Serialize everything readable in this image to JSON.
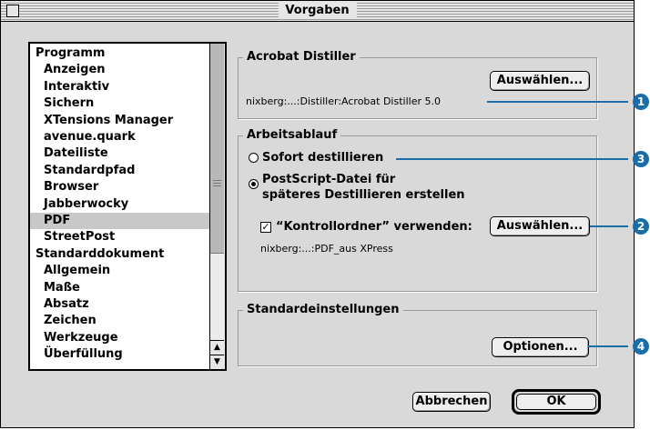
{
  "window": {
    "title": "Vorgaben"
  },
  "sidebar": {
    "items": [
      {
        "label": "Programm",
        "indent": 0,
        "selected": false
      },
      {
        "label": "Anzeigen",
        "indent": 1,
        "selected": false
      },
      {
        "label": "Interaktiv",
        "indent": 1,
        "selected": false
      },
      {
        "label": "Sichern",
        "indent": 1,
        "selected": false
      },
      {
        "label": "XTensions Manager",
        "indent": 1,
        "selected": false
      },
      {
        "label": "avenue.quark",
        "indent": 1,
        "selected": false
      },
      {
        "label": "Dateiliste",
        "indent": 1,
        "selected": false
      },
      {
        "label": "Standardpfad",
        "indent": 1,
        "selected": false
      },
      {
        "label": "Browser",
        "indent": 1,
        "selected": false
      },
      {
        "label": "Jabberwocky",
        "indent": 1,
        "selected": false
      },
      {
        "label": "PDF",
        "indent": 1,
        "selected": true
      },
      {
        "label": "StreetPost",
        "indent": 1,
        "selected": false
      },
      {
        "label": "Standarddokument",
        "indent": 0,
        "selected": false
      },
      {
        "label": "Allgemein",
        "indent": 1,
        "selected": false
      },
      {
        "label": "Maße",
        "indent": 1,
        "selected": false
      },
      {
        "label": "Absatz",
        "indent": 1,
        "selected": false
      },
      {
        "label": "Zeichen",
        "indent": 1,
        "selected": false
      },
      {
        "label": "Werkzeuge",
        "indent": 1,
        "selected": false
      },
      {
        "label": "Überfüllung",
        "indent": 1,
        "selected": false
      }
    ]
  },
  "distiller": {
    "title": "Acrobat Distiller",
    "select_label": "Auswählen...",
    "path": "nixberg:...:Distiller:Acrobat Distiller 5.0"
  },
  "workflow": {
    "title": "Arbeitsablauf",
    "option_immediate": "Sofort destillieren",
    "option_postscript_line1": "PostScript-Datei für",
    "option_postscript_line2": "späteres Destillieren erstellen",
    "watch_folder_label": "“Kontrollordner” verwenden:",
    "watch_folder_checked": true,
    "select_label": "Auswählen...",
    "folder_path": "nixberg:...:PDF_aus XPress",
    "selected_option": "postscript"
  },
  "defaults": {
    "title": "Standardeinstellungen",
    "options_label": "Optionen..."
  },
  "footer": {
    "cancel_label": "Abbrechen",
    "ok_label": "OK"
  },
  "callouts": [
    "1",
    "3",
    "2",
    "4"
  ],
  "colors": {
    "callout": "#1a6ea8",
    "window_bg": "#d9d9d9",
    "selection": "#c8c8c8"
  }
}
